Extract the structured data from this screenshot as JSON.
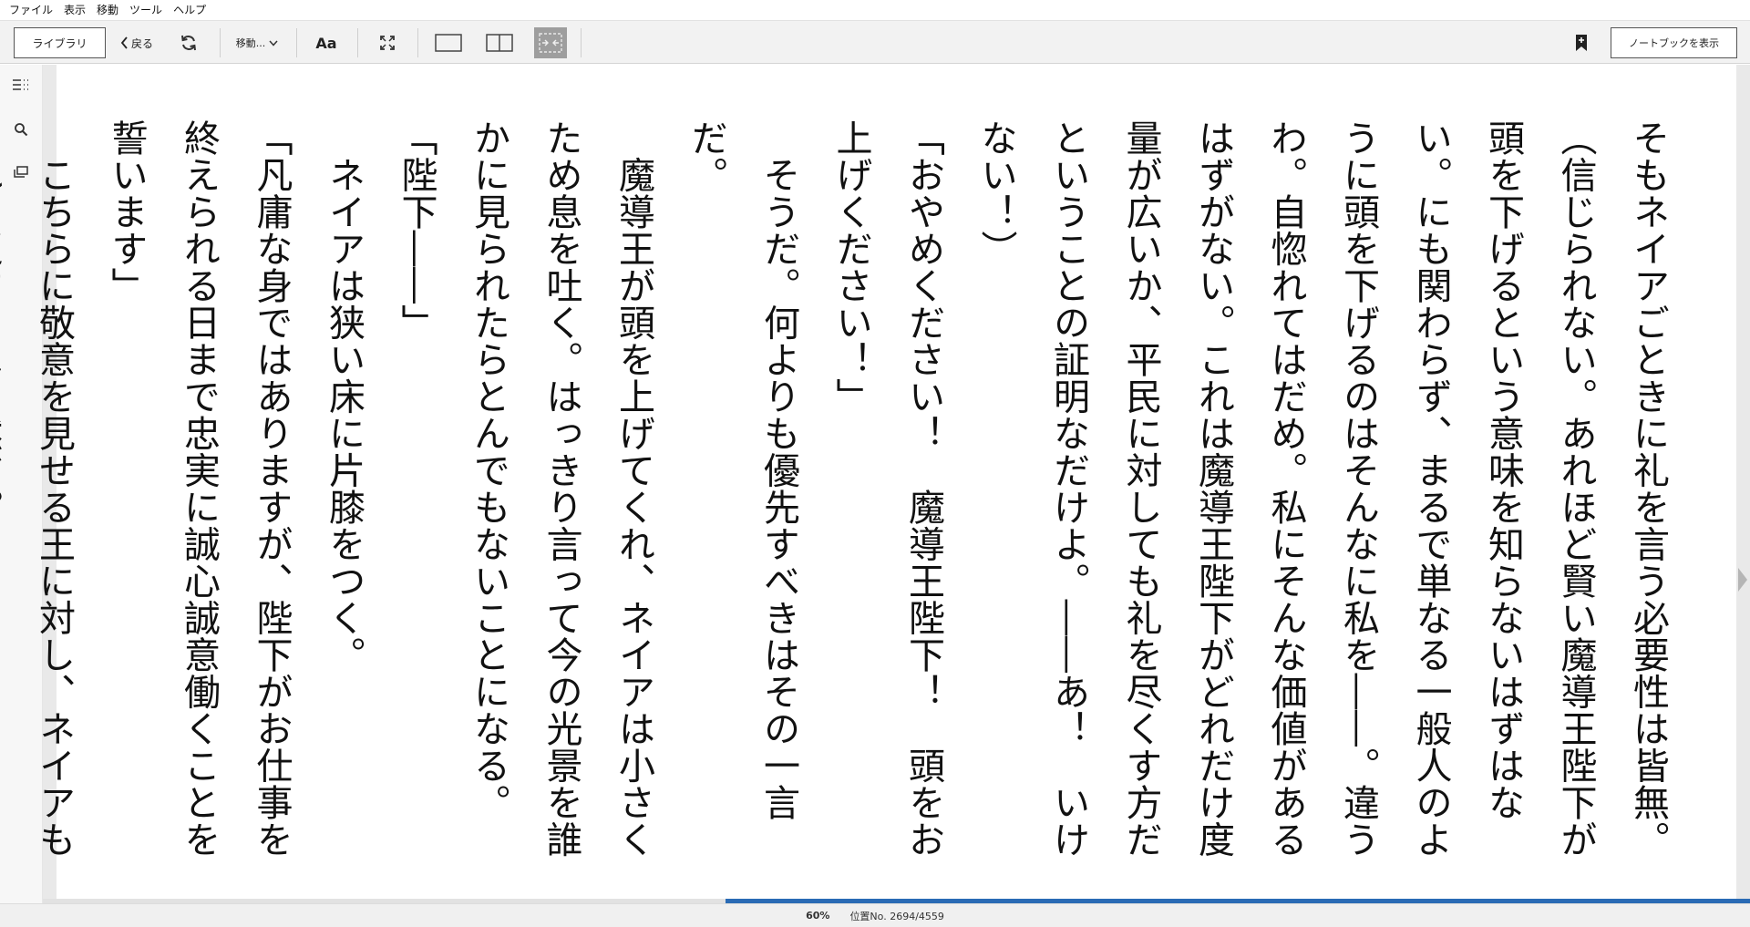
{
  "menu": [
    "ファイル",
    "表示",
    "移動",
    "ツール",
    "ヘルプ"
  ],
  "toolbar": {
    "library_label": "ライブラリ",
    "back_label": "戻る",
    "goto_label": "移動...",
    "font_label": "Aa",
    "notebook_label": "ノートブックを表示"
  },
  "icons": {
    "back": "chevron-left-icon",
    "sync": "refresh-icon",
    "goto_dropdown": "chevron-down-icon",
    "fullscreen": "expand-icon",
    "single_page": "single-page-icon",
    "two_page": "two-page-icon",
    "fit": "fit-page-icon",
    "bookmark": "bookmark-add-icon",
    "toc": "table-of-contents-icon",
    "search": "search-icon",
    "flashcards": "flashcards-icon",
    "next": "next-page-icon"
  },
  "reader": {
    "paragraphs": [
      "そもネイアごときに礼を言う必要性は皆無。",
      "（信じられない。あれほど賢い魔導王陛下が頭を下げるという意味を知らないはずはない。にも関わらず、まるで単なる一般人のように頭を下げるのはそんなに私を――。違うわ。自惚れてはだめ。私にそんな価値があるはずがない。これは魔導王陛下がどれだけ度量が広いか、平民に対しても礼を尽くす方だということの証明なだけよ。――あ！　いけない！）",
      "「おやめください！　魔導王陛下！　頭をお上げください！」",
      "　そうだ。何よりも優先すべきはその一言だ。",
      "　魔導王が頭を上げてくれ、ネイアは小さくため息を吐く。はっきり言って今の光景を誰かに見られたらとんでもないことになる。",
      "「陛下――」",
      "　ネイアは狭い床に片膝をつく。",
      "「凡庸な身ではありますが、陛下がお仕事を終えられる日まで忠実に誠心誠意働くことを誓います」",
      "　こちらに敬意を見せる王に対し、ネイアもそれを返すのは当然だ。"
    ]
  },
  "status": {
    "percent": "60%",
    "location": "位置No. 2694/4559",
    "progress_fraction": 0.6
  },
  "colors": {
    "progress": "#2a6bb5",
    "toolbar_bg": "#f2f2f2",
    "active_view_bg": "#9e9e9e"
  }
}
